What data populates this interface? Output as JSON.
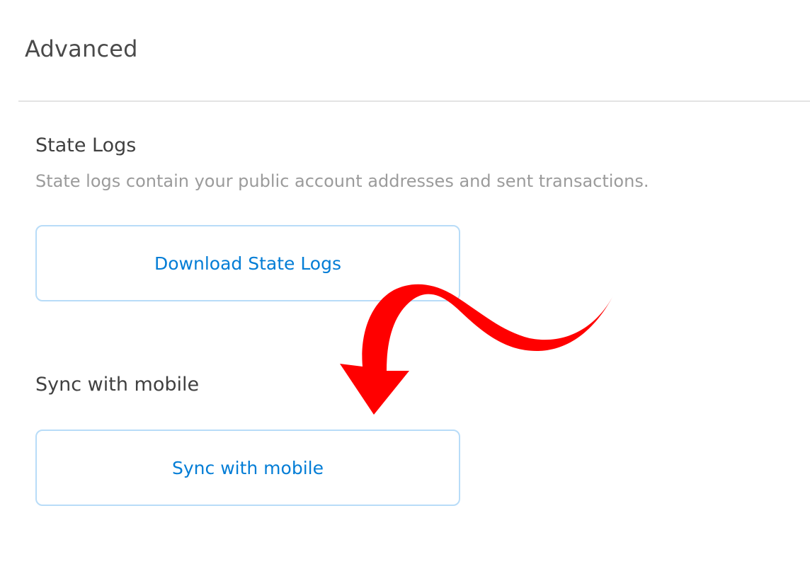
{
  "header": {
    "title": "Advanced"
  },
  "state_logs": {
    "title": "State Logs",
    "description": "State logs contain your public account addresses and sent transactions.",
    "button_label": "Download State Logs"
  },
  "sync_mobile": {
    "title": "Sync with mobile",
    "button_label": "Sync with mobile"
  },
  "annotation": {
    "icon": "curved-arrow-icon",
    "color": "#ff0000"
  },
  "colors": {
    "accent": "#037dd6",
    "button_border": "#b8dcf8",
    "title_text": "#404040",
    "muted_text": "#9b9b9b",
    "divider": "#e3e3e3"
  }
}
